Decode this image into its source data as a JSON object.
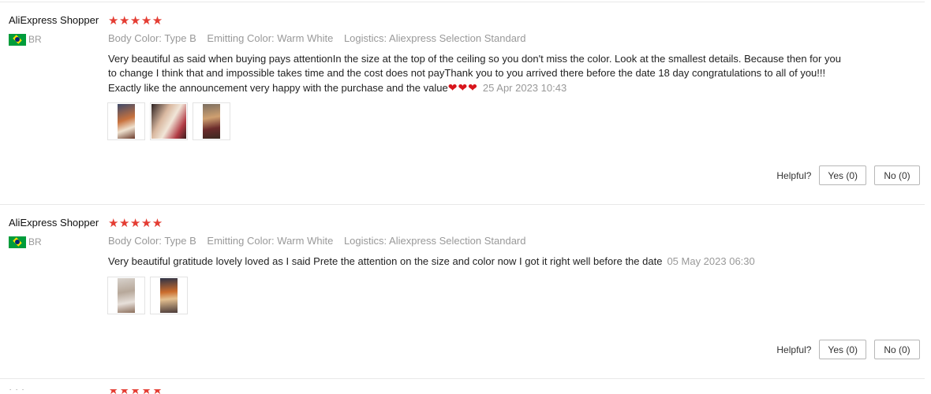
{
  "reviews": [
    {
      "user": "AliExpress Shopper",
      "stars": "★★★★★",
      "country": "BR",
      "attributes": [
        {
          "key": "Body Color:",
          "value": "Type B"
        },
        {
          "key": "Emitting Color:",
          "value": "Warm White"
        },
        {
          "key": "Logistics:",
          "value": "Aliexpress Selection Standard"
        }
      ],
      "text": "Very beautiful as said when buying pays attentionIn the size at the top of the ceiling so you don't miss the color. Look at the smallest details. Because then for you to change I think that and impossible takes time and the cost does not payThank you to you arrived there before the date 18 day congratulations to all of you!!! Exactly like the announcement very happy with the purchase and the value",
      "emoji": "❤❤❤",
      "date": "25 Apr 2023 10:43",
      "helpful_label": "Helpful?",
      "yes_label": "Yes (0)",
      "no_label": "No (0)"
    },
    {
      "user": "AliExpress Shopper",
      "stars": "★★★★★",
      "country": "BR",
      "attributes": [
        {
          "key": "Body Color:",
          "value": "Type B"
        },
        {
          "key": "Emitting Color:",
          "value": "Warm White"
        },
        {
          "key": "Logistics:",
          "value": "Aliexpress Selection Standard"
        }
      ],
      "text": "Very beautiful gratitude lovely loved as I said Prete the attention on the size and color now I got it right well before the date",
      "date": "05 May 2023 06:30",
      "helpful_label": "Helpful?",
      "yes_label": "Yes (0)",
      "no_label": "No (0)"
    },
    {
      "user": "· · ·",
      "stars": "★★★★★"
    }
  ],
  "icons": {
    "flag": "brazil-flag-icon",
    "star": "star-icon",
    "heart": "heart-icon"
  },
  "colors": {
    "star": "#e43d33",
    "heart": "#d8151c",
    "muted_text": "#999999"
  }
}
